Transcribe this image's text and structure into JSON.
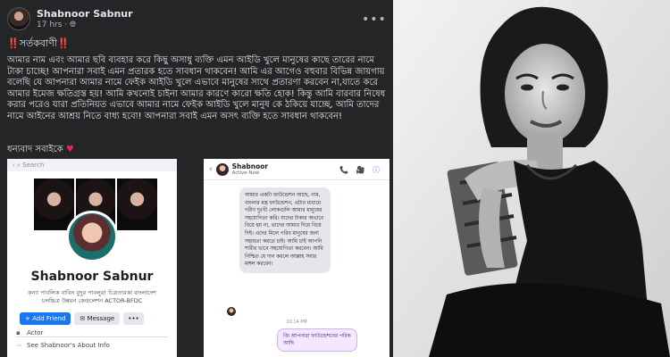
{
  "post": {
    "author": "Shabnoor Sabnur",
    "time": "17 hrs",
    "privacy_icon": "globe-icon",
    "more_icon": "ellipsis-icon",
    "warning_marks": "‼️",
    "warning": "সর্তকবাণী",
    "body": "আমার নাম এবং আমার ছবি ব্যবহার করে কিছু অসাধু ব্যক্তি এমন আইডি খুলে মানুষের কাছে তারের নামে টাকা চাচ্ছে! আপনারা সবাই এমন প্রতারক হতে সাবধান থাকবেন! আমি এর আগেও বহুবার বিভিন্ন জায়গায় বলেছি যে আপনারা আমার নামে ফেইক আইডি খুলে এভাবে মানুষের সাথে প্রতারণা করবেন না,যাতে করে আমার ইমেজ ক্ষতিগ্রস্ত হয়! আমি কখনোই চাইনা আমার কারণে কারো ক্ষতি হোক! কিন্তু আমি বারবার নিষেধ করার পরেও যারা প্রতিনিয়ত এভাবে আমার নামে ফেইক আইডি খুলে মানুষ কে ঠকিয়ে যাচ্ছে, আমি তাদের নামে আইনের আশ্রয় নিতে বাধ্য হবো! আপনারা সবাই এমন অসৎ ব্যক্তি হতে সাবধান থাকবেন!",
    "thanks": "ধন্যবাদ সবাইকে",
    "heart": "♥"
  },
  "profile_screenshot": {
    "search": "Search",
    "name": "Shabnoor Sabnur",
    "bio": "কন্যা পাবলিক বাবিন বুদুর পাবলুর! চিত্রতারকা বাংলাদেশ চলচ্চিত্র উন্নয়ন কেন্দ্রলেশন ACTOR-BFDC",
    "add_friend": "Add Friend",
    "message": "Message",
    "more": "•••",
    "info_1": "Actor",
    "info_2": "See Shabnoor's About Info"
  },
  "chat_screenshot": {
    "name": "Shabnoor",
    "status": "Active Now",
    "header_icons": "📞 🎥 ⓘ",
    "message": "আমার একটা ফাউন্ডেশন আছে, নাম, বাংলার মন্ত্র ফাউন্ডেশন, এটার মাধ্যমে গরীব দুঃখী লোকগুলি আমার মানুষের সহযোগিতা করি। যাদের টাকার অভাবে বিয়ে হয় না, তাদের আমার দিয়ে বিয়ে দিই। এদের মিলে গরিব মানুষের জন্য সহায়তা করতে চাই। আমি চাই আপনি শারীর ভাবে সহযোগিতা করবেন। আমি নিশ্চিত যে দান করলে আল্লাহ সবার মঙ্গল করবেন।",
    "timestamp": "10:14 PM",
    "reply": "জি আপনারা ফাউন্ডেশনের পরিক আছি"
  }
}
